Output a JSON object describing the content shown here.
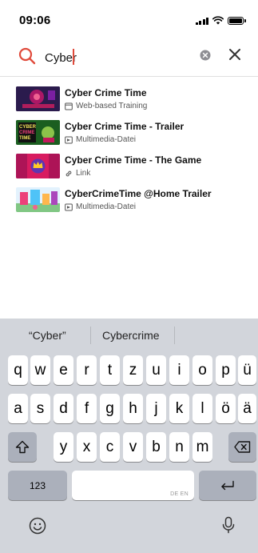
{
  "status": {
    "time": "09:06"
  },
  "search": {
    "query": "Cyber",
    "placeholder": ""
  },
  "results": [
    {
      "title": "Cyber Crime Time",
      "type": "Web-based Training",
      "type_icon": "window-icon",
      "thumb_style": "dark-pink-scene"
    },
    {
      "title": "Cyber Crime Time - Trailer",
      "type": "Multimedia-Datei",
      "type_icon": "media-icon",
      "thumb_style": "green-logo"
    },
    {
      "title": "Cyber Crime Time - The Game",
      "type": "Link",
      "type_icon": "link-icon",
      "thumb_style": "magenta-crown"
    },
    {
      "title": "CyberCrimeTime @Home Trailer",
      "type": "Multimedia-Datei",
      "type_icon": "media-icon",
      "thumb_style": "colorful-room"
    }
  ],
  "keyboard": {
    "suggestions": [
      "“Cyber”",
      "Cybercrime"
    ],
    "row1": [
      "q",
      "w",
      "e",
      "r",
      "t",
      "z",
      "u",
      "i",
      "o",
      "p",
      "ü"
    ],
    "row2": [
      "a",
      "s",
      "d",
      "f",
      "g",
      "h",
      "j",
      "k",
      "l",
      "ö",
      "ä"
    ],
    "row3": [
      "y",
      "x",
      "c",
      "v",
      "b",
      "n",
      "m"
    ],
    "numbers_label": "123",
    "space_hint": "DE EN"
  },
  "colors": {
    "accent": "#e04a3b",
    "keyboard_bg": "#d2d5db",
    "dark_key": "#abb0bb"
  }
}
